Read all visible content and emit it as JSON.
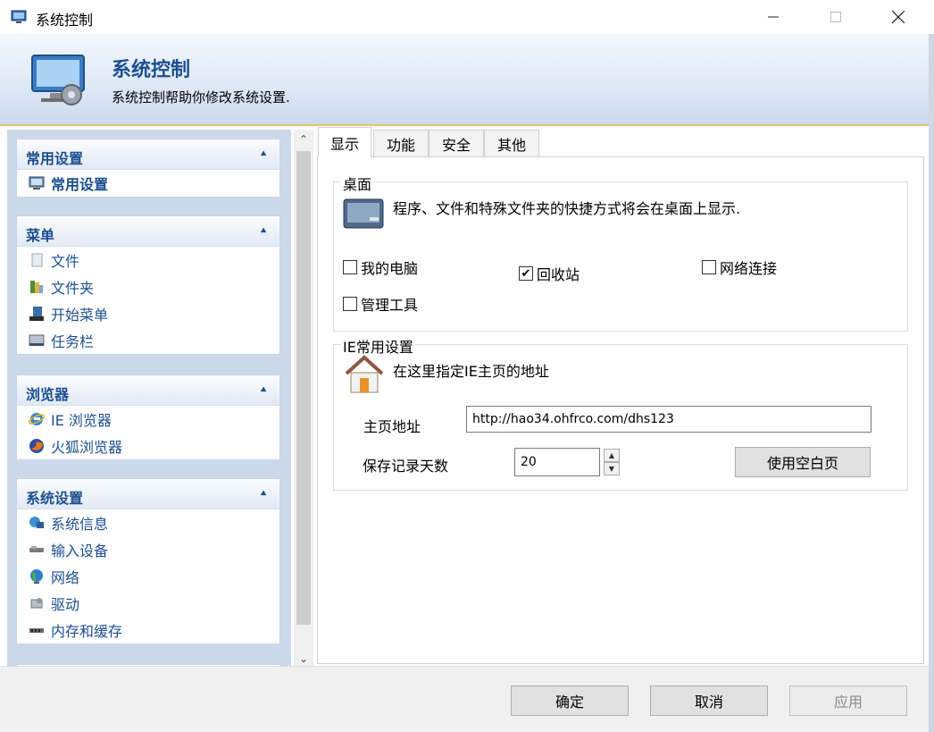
{
  "window": {
    "title": "系统控制"
  },
  "header": {
    "title": "系统控制",
    "subtitle": "系统控制帮助你修改系统设置."
  },
  "sidebar": {
    "groups": [
      {
        "title": "常用设置",
        "items": [
          {
            "label": "常用设置",
            "icon": "monitor-settings-icon",
            "selected": true
          }
        ]
      },
      {
        "title": "菜单",
        "items": [
          {
            "label": "文件",
            "icon": "file-icon"
          },
          {
            "label": "文件夹",
            "icon": "folder-icon"
          },
          {
            "label": "开始菜单",
            "icon": "start-menu-icon"
          },
          {
            "label": "任务栏",
            "icon": "taskbar-icon"
          }
        ]
      },
      {
        "title": "浏览器",
        "items": [
          {
            "label": "IE 浏览器",
            "icon": "ie-browser-icon"
          },
          {
            "label": "火狐浏览器",
            "icon": "firefox-icon"
          }
        ]
      },
      {
        "title": "系统设置",
        "items": [
          {
            "label": "系统信息",
            "icon": "system-info-icon"
          },
          {
            "label": "输入设备",
            "icon": "input-device-icon"
          },
          {
            "label": "网络",
            "icon": "network-globe-icon"
          },
          {
            "label": "驱动",
            "icon": "driver-icon"
          },
          {
            "label": "内存和缓存",
            "icon": "memory-icon"
          }
        ]
      }
    ]
  },
  "tabs": [
    {
      "label": "显示",
      "active": true
    },
    {
      "label": "功能"
    },
    {
      "label": "安全"
    },
    {
      "label": "其他"
    }
  ],
  "desktop": {
    "legend": "桌面",
    "description": "程序、文件和特殊文件夹的快捷方式将会在桌面上显示.",
    "checkboxes": [
      {
        "label": "我的电脑",
        "checked": false
      },
      {
        "label": "回收站",
        "checked": true
      },
      {
        "label": "网络连接",
        "checked": false
      },
      {
        "label": "管理工具",
        "checked": false
      }
    ]
  },
  "ie": {
    "legend": "IE常用设置",
    "description": "在这里指定IE主页的地址",
    "homepage_label": "主页地址",
    "homepage_value": "http://hao34.ohfrco.com/dhs123",
    "history_label": "保存记录天数",
    "history_value": "20",
    "blank_button": "使用空白页"
  },
  "footer": {
    "ok": "确定",
    "cancel": "取消",
    "apply": "应用"
  },
  "colors": {
    "accent": "#1c4f91",
    "header_line": "#e6c07a"
  }
}
